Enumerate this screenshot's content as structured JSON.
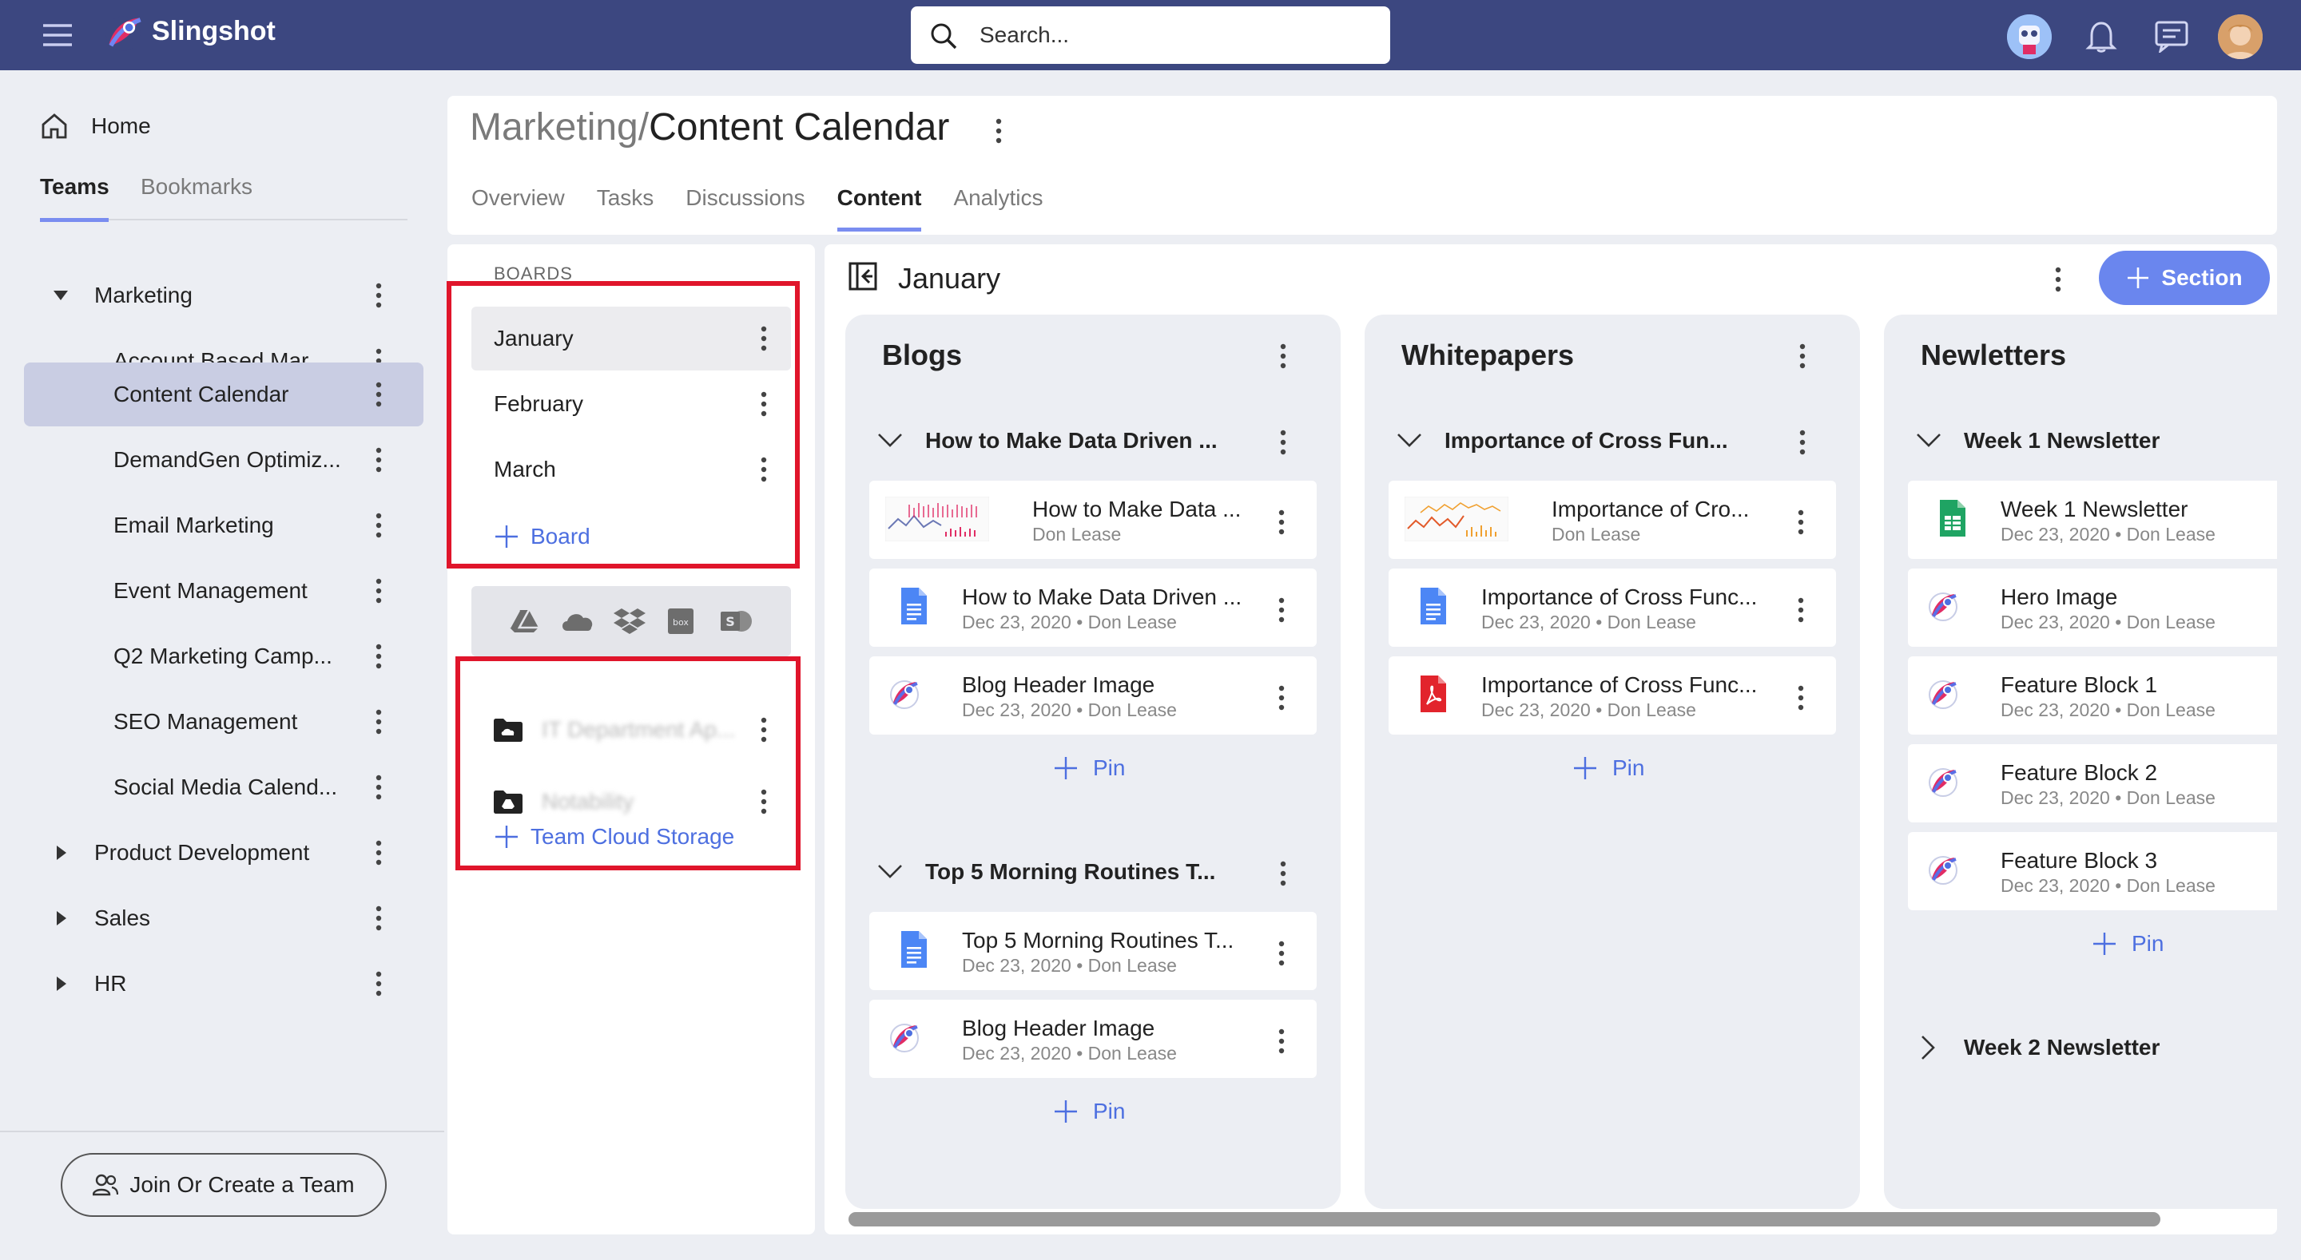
{
  "app": {
    "brand": "Slingshot"
  },
  "topbar": {
    "search_placeholder": "Search..."
  },
  "sidebar": {
    "home": "Home",
    "tabs": [
      {
        "label": "Teams"
      },
      {
        "label": "Bookmarks"
      }
    ],
    "teams": [
      {
        "label": "Marketing"
      },
      {
        "label": "Account Based Mar..."
      },
      {
        "label": "Content Calendar"
      },
      {
        "label": "DemandGen Optimiz..."
      },
      {
        "label": "Email Marketing"
      },
      {
        "label": "Event Management"
      },
      {
        "label": "Q2 Marketing Camp..."
      },
      {
        "label": "SEO Management"
      },
      {
        "label": "Social Media Calend..."
      },
      {
        "label": "Product Development"
      },
      {
        "label": "Sales"
      },
      {
        "label": "HR"
      }
    ],
    "join_button": "Join Or Create a Team"
  },
  "header": {
    "crumb_parent": "Marketing",
    "crumb_sep": "/",
    "title": "Content Calendar",
    "tabs": [
      {
        "label": "Overview"
      },
      {
        "label": "Tasks"
      },
      {
        "label": "Discussions"
      },
      {
        "label": "Content"
      },
      {
        "label": "Analytics"
      }
    ]
  },
  "boards": {
    "title": "BOARDS",
    "items": [
      {
        "label": "January"
      },
      {
        "label": "February"
      },
      {
        "label": "March"
      }
    ],
    "add_label": "Board",
    "cloud_items": [
      {
        "label": "IT Department Ap..."
      },
      {
        "label": "Notability"
      }
    ],
    "cloud_add_label": "Team Cloud Storage"
  },
  "canvas": {
    "title": "January",
    "section_button": "Section"
  },
  "columns": [
    {
      "title": "Blogs",
      "groups": [
        {
          "title": "How to Make Data Driven ...",
          "cards": [
            {
              "title": "How to Make Data ...",
              "meta": "Don Lease",
              "icon": "chart-thumbnail-icon"
            },
            {
              "title": "How to Make Data Driven ...",
              "meta": "Dec 23, 2020 • Don Lease",
              "icon": "google-doc-icon"
            },
            {
              "title": "Blog Header Image",
              "meta": "Dec 23, 2020 • Don Lease",
              "icon": "slingshot-image-icon"
            }
          ],
          "pin_label": "Pin"
        },
        {
          "title": "Top 5 Morning Routines T...",
          "cards": [
            {
              "title": "Top 5 Morning Routines T...",
              "meta": "Dec 23, 2020 • Don Lease",
              "icon": "google-doc-icon"
            },
            {
              "title": "Blog Header Image",
              "meta": "Dec 23, 2020 • Don Lease",
              "icon": "slingshot-image-icon"
            }
          ],
          "pin_label": "Pin"
        }
      ]
    },
    {
      "title": "Whitepapers",
      "groups": [
        {
          "title": "Importance of Cross Fun...",
          "cards": [
            {
              "title": "Importance of Cro...",
              "meta": "Don Lease",
              "icon": "chart-thumbnail-icon"
            },
            {
              "title": "Importance of Cross Func...",
              "meta": "Dec 23, 2020 • Don Lease",
              "icon": "google-doc-icon"
            },
            {
              "title": "Importance of Cross Func...",
              "meta": "Dec 23, 2020 • Don Lease",
              "icon": "pdf-icon"
            }
          ],
          "pin_label": "Pin"
        }
      ]
    },
    {
      "title": "Newletters",
      "groups": [
        {
          "title": "Week 1 Newsletter",
          "cards": [
            {
              "title": "Week 1 Newsletter",
              "meta": "Dec 23, 2020 • Don Lease",
              "icon": "google-sheet-icon"
            },
            {
              "title": "Hero Image",
              "meta": "Dec 23, 2020 • Don Lease",
              "icon": "slingshot-image-icon"
            },
            {
              "title": "Feature Block 1",
              "meta": "Dec 23, 2020 • Don Lease",
              "icon": "slingshot-image-icon"
            },
            {
              "title": "Feature Block 2",
              "meta": "Dec 23, 2020 • Don Lease",
              "icon": "slingshot-image-icon"
            },
            {
              "title": "Feature Block 3",
              "meta": "Dec 23, 2020 • Don Lease",
              "icon": "slingshot-image-icon"
            }
          ],
          "pin_label": "Pin"
        },
        {
          "title": "Week 2 Newsletter"
        }
      ]
    }
  ]
}
